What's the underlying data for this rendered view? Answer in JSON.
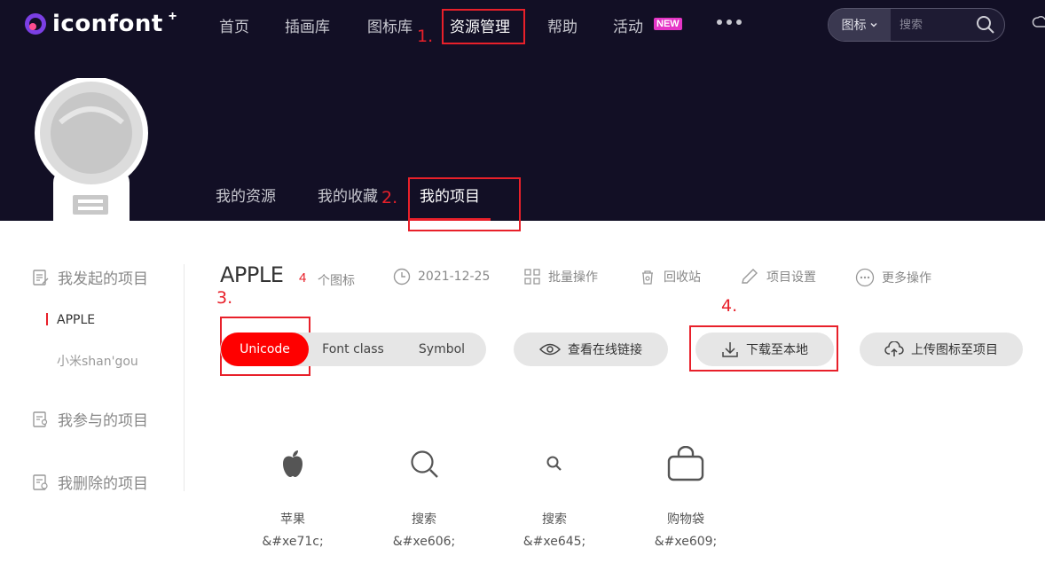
{
  "logo": {
    "text": "iconfont",
    "plus": "+"
  },
  "nav": {
    "items": [
      "首页",
      "插画库",
      "图标库",
      "资源管理",
      "帮助",
      "活动"
    ],
    "new_badge": "NEW"
  },
  "search": {
    "type_label": "图标",
    "placeholder": "搜索"
  },
  "subnav": {
    "items": [
      "我的资源",
      "我的收藏",
      "我的项目"
    ]
  },
  "annotations": [
    "1.",
    "2.",
    "3.",
    "4.",
    "4."
  ],
  "sidebar": {
    "group_started": "我发起的项目",
    "projects": [
      "APPLE",
      "小米shan'gou"
    ],
    "group_joined": "我参与的项目",
    "group_deleted": "我删除的项目"
  },
  "project": {
    "title": "APPLE",
    "icon_count": "4",
    "icon_unit": "个图标",
    "date": "2021-12-25",
    "batch": "批量操作",
    "recycle": "回收站",
    "settings": "项目设置",
    "more": "更多操作"
  },
  "format_tabs": {
    "unicode": "Unicode",
    "font_class": "Font class",
    "symbol": "Symbol"
  },
  "actions": {
    "view_link": "查看在线链接",
    "download": "下载至本地",
    "upload": "上传图标至项目"
  },
  "icons": [
    {
      "name": "苹果",
      "code": "&#xe71c;",
      "icon": "apple-icon"
    },
    {
      "name": "搜索",
      "code": "&#xe606;",
      "icon": "search-icon"
    },
    {
      "name": "搜索",
      "code": "&#xe645;",
      "icon": "search-small-icon"
    },
    {
      "name": "购物袋",
      "code": "&#xe609;",
      "icon": "shopping-bag-icon"
    }
  ],
  "colors": {
    "header_bg": "#120f25",
    "accent": "#ff0000",
    "annotation": "#e8202a"
  }
}
